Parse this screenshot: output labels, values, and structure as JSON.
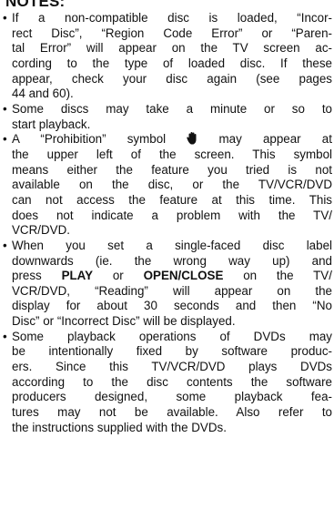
{
  "heading": "NOTES:",
  "notes": [
    {
      "lines": [
        "If a non-compatible disc is loaded, “Incor-",
        "rect Disc”, “Region Code Error” or “Paren-",
        "tal Error” will appear on the TV screen ac-",
        "cording to the type of loaded disc. If these",
        "appear, check your disc again (see pages",
        "44 and 60)."
      ]
    },
    {
      "lines": [
        "Some discs may take a minute or so to",
        "start playback."
      ]
    },
    {
      "line1_before": "A “Prohibition” symbol",
      "line1_after": "may appear at",
      "icon": "prohibition-hand-icon",
      "lines": [
        "the upper left of the screen. This symbol",
        "means either the feature you tried is not",
        "available on the disc, or the TV/VCR/DVD",
        "can not access the feature at this time. This",
        "does not indicate a problem with the TV/",
        "VCR/DVD."
      ]
    },
    {
      "line1": "When you set a single-faced disc label",
      "line2": "downwards (ie. the wrong way up) and",
      "line3_before": "press",
      "play": "PLAY",
      "line3_or": "or",
      "open_close": "OPEN/CLOSE",
      "line3_after": "on the TV/",
      "lines": [
        "VCR/DVD, “Reading” will appear on the",
        "display for about 30 seconds and then “No",
        "Disc” or “Incorrect Disc” will be displayed."
      ]
    },
    {
      "lines": [
        "Some playback operations of DVDs may",
        "be intentionally fixed by software produc-",
        "ers. Since this TV/VCR/DVD plays DVDs",
        "according to the disc contents the software",
        "producers designed, some playback fea-",
        "tures may not be available. Also refer to",
        "the instructions supplied with the DVDs."
      ]
    }
  ]
}
